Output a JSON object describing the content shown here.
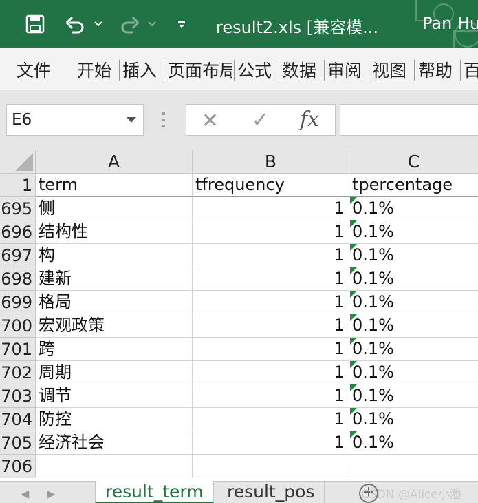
{
  "titlebar": {
    "title": "result2.xls  [兼容模...",
    "user": "Pan Hu",
    "icons": [
      "save-icon",
      "undo-icon",
      "undo-dropdown-icon",
      "redo-icon",
      "redo-dropdown-icon",
      "customize-quick-access-icon"
    ]
  },
  "ribbon": {
    "tabs": [
      "文件",
      "开始",
      "插入",
      "页面布局",
      "公式",
      "数据",
      "审阅",
      "视图",
      "帮助",
      "百"
    ]
  },
  "formula_bar": {
    "name_box": "E6",
    "cancel_glyph": "✕",
    "enter_glyph": "✓",
    "fx_glyph": "fx",
    "formula_value": ""
  },
  "grid": {
    "corner": "",
    "columns": [
      "A",
      "B",
      "C"
    ],
    "header_row": {
      "row": "1",
      "a": "term",
      "b": "tfrequency",
      "c": "tpercentage"
    },
    "rows": [
      {
        "row": "695",
        "a": "侧",
        "b": "1",
        "c": "0.1%"
      },
      {
        "row": "696",
        "a": "结构性",
        "b": "1",
        "c": "0.1%"
      },
      {
        "row": "697",
        "a": "构",
        "b": "1",
        "c": "0.1%"
      },
      {
        "row": "698",
        "a": "建新",
        "b": "1",
        "c": "0.1%"
      },
      {
        "row": "699",
        "a": "格局",
        "b": "1",
        "c": "0.1%"
      },
      {
        "row": "700",
        "a": "宏观政策",
        "b": "1",
        "c": "0.1%"
      },
      {
        "row": "701",
        "a": "跨",
        "b": "1",
        "c": "0.1%"
      },
      {
        "row": "702",
        "a": "周期",
        "b": "1",
        "c": "0.1%"
      },
      {
        "row": "703",
        "a": "调节",
        "b": "1",
        "c": "0.1%"
      },
      {
        "row": "704",
        "a": "防控",
        "b": "1",
        "c": "0.1%"
      },
      {
        "row": "705",
        "a": "经济社会",
        "b": "1",
        "c": "0.1%"
      },
      {
        "row": "706",
        "a": "",
        "b": "",
        "c": ""
      }
    ]
  },
  "sheets": {
    "tabs": [
      {
        "label": "result_term",
        "active": true
      },
      {
        "label": "result_pos",
        "active": false
      }
    ],
    "add_label": "+"
  },
  "watermark": "CSDN @Alice小潘",
  "colors": {
    "excel_green": "#217346",
    "error_indicator": "#1e8e3e"
  }
}
